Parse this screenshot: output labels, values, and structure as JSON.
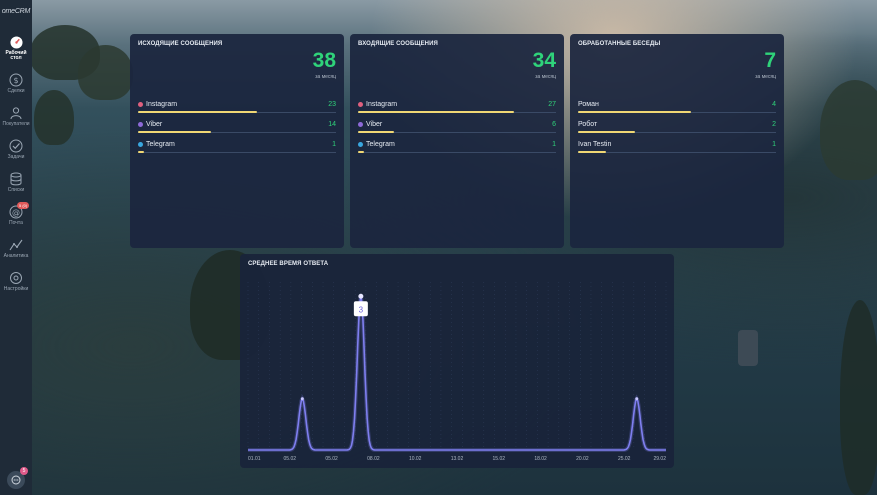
{
  "sidebar": {
    "logo": "omeCRM",
    "items": [
      {
        "label": "Рабочий стол",
        "icon": "dashboard-icon",
        "active": true
      },
      {
        "label": "Сделки",
        "icon": "dollar-icon"
      },
      {
        "label": "Покупатели",
        "icon": "users-icon"
      },
      {
        "label": "Задачи",
        "icon": "check-icon"
      },
      {
        "label": "Списки",
        "icon": "database-icon"
      },
      {
        "label": "Почта",
        "icon": "mail-icon",
        "badge": "5 (0)"
      },
      {
        "label": "Аналитика",
        "icon": "analytics-icon"
      },
      {
        "label": "Настройки",
        "icon": "settings-icon"
      }
    ],
    "chat_badge": "5"
  },
  "colors": {
    "accent_green": "#2fd37a",
    "bar_yellow": "#f0d774",
    "chart_line": "#7f7ff0",
    "sidebar_bg": "#1f2b38"
  },
  "outgoing": {
    "title": "ИСХОДЯЩИЕ СООБЩЕНИЯ",
    "total": "38",
    "period": "за месяц",
    "rows": [
      {
        "name": "Instagram",
        "value": "23",
        "fraction": 0.6,
        "dot": "#e0607e"
      },
      {
        "name": "Viber",
        "value": "14",
        "fraction": 0.37,
        "dot": "#8e6ad8"
      },
      {
        "name": "Telegram",
        "value": "1",
        "fraction": 0.03,
        "dot": "#39a7e0"
      }
    ]
  },
  "incoming": {
    "title": "ВХОДЯЩИЕ СООБЩЕНИЯ",
    "total": "34",
    "period": "за месяц",
    "rows": [
      {
        "name": "Instagram",
        "value": "27",
        "fraction": 0.79,
        "dot": "#e0607e"
      },
      {
        "name": "Viber",
        "value": "6",
        "fraction": 0.18,
        "dot": "#8e6ad8"
      },
      {
        "name": "Telegram",
        "value": "1",
        "fraction": 0.03,
        "dot": "#39a7e0"
      }
    ]
  },
  "processed": {
    "title": "ОБРАБОТАННЫЕ БЕСЕДЫ",
    "total": "7",
    "period": "за месяц",
    "rows": [
      {
        "name": "Роман",
        "value": "4",
        "fraction": 0.57
      },
      {
        "name": "Робот",
        "value": "2",
        "fraction": 0.29
      },
      {
        "name": "Ivan Testin",
        "value": "1",
        "fraction": 0.14
      }
    ]
  },
  "chart_data": {
    "type": "line",
    "title": "СРЕДНЕЕ ВРЕМЯ ОТВЕТА",
    "x_ticks": [
      "01.01",
      "05.02",
      "05.02",
      "08.02",
      "10.02",
      "13.02",
      "15.02",
      "18.02",
      "20.02",
      "25.02",
      "29.02"
    ],
    "ylim": [
      0,
      3.2
    ],
    "peaks": [
      {
        "x_index": 1.3,
        "value": 1.0
      },
      {
        "x_index": 2.7,
        "value": 3.0
      },
      {
        "x_index": 9.3,
        "value": 1.0
      }
    ],
    "highlight": {
      "label": "3",
      "value": 3
    }
  }
}
